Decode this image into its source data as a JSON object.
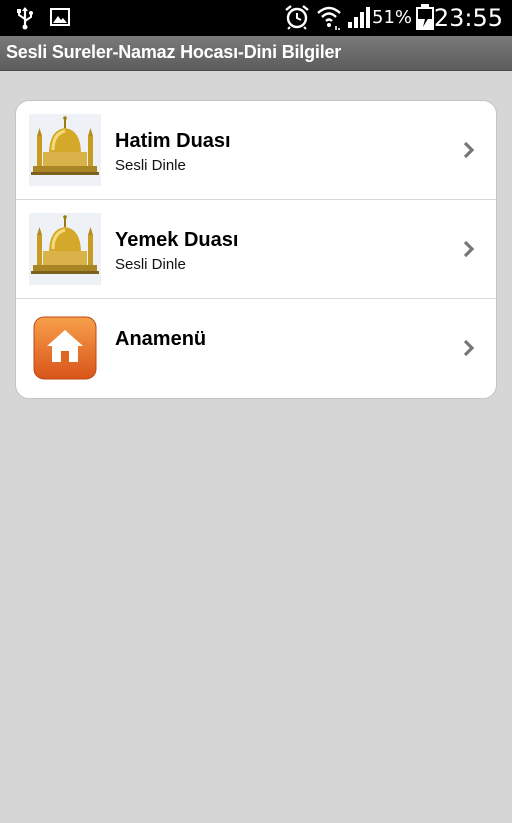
{
  "status_bar": {
    "battery_percent": "51%",
    "time": "23:55",
    "icons": [
      "usb-icon",
      "image-icon",
      "alarm-icon",
      "wifi-icon",
      "signal-icon",
      "battery-charging-icon"
    ]
  },
  "app": {
    "title": "Sesli Sureler-Namaz Hocası-Dini Bilgiler"
  },
  "menu": {
    "items": [
      {
        "title": "Hatim Duası",
        "subtitle": "Sesli Dinle",
        "icon": "mosque-icon"
      },
      {
        "title": "Yemek Duası",
        "subtitle": "Sesli Dinle",
        "icon": "mosque-icon"
      },
      {
        "title": "Anamenü",
        "subtitle": "",
        "icon": "home-icon"
      }
    ]
  },
  "colors": {
    "background": "#d6d6d6",
    "title_bar": "#6a6a6a",
    "home_icon": "#e0661e",
    "dome_gold": "#d4a92a"
  }
}
